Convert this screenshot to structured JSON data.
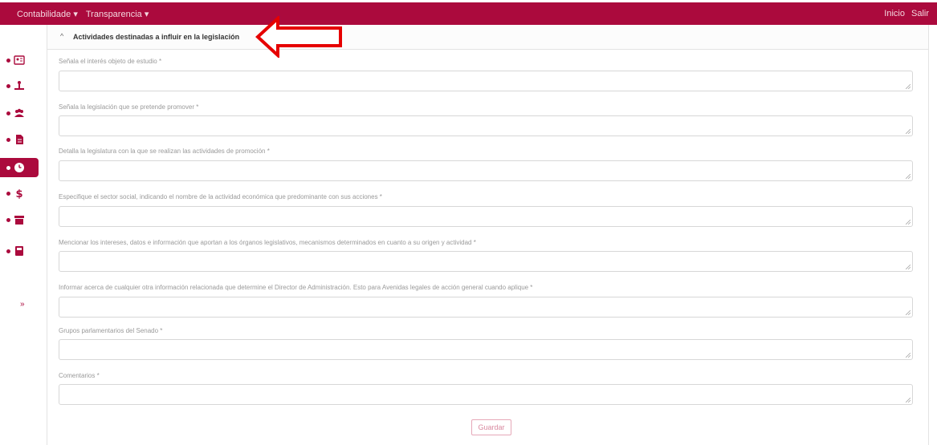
{
  "topbar": {
    "nav": [
      {
        "label": "Contabilidade ▾"
      },
      {
        "label": "Transparencia ▾"
      }
    ],
    "right": [
      {
        "label": "Inicio"
      },
      {
        "label": "Salir"
      }
    ]
  },
  "sidebar": {
    "items": [
      {
        "icon": "id-card-icon"
      },
      {
        "icon": "person-desk-icon"
      },
      {
        "icon": "group-icon"
      },
      {
        "icon": "document-icon"
      },
      {
        "icon": "clock-icon",
        "active": true
      },
      {
        "icon": "dollar-icon"
      },
      {
        "icon": "archive-icon"
      },
      {
        "icon": "book-icon"
      }
    ],
    "collapse_label": "»"
  },
  "panel": {
    "header_chevron": "^",
    "header_title": "Actividades destinadas a influir en la legislación"
  },
  "form": {
    "fields": [
      {
        "label": "Señala el interés objeto de estudio *"
      },
      {
        "label": "Señala la legislación que se pretende promover *"
      },
      {
        "label": "Detalla la legislatura con la que se realizan las actividades de promoción *"
      },
      {
        "label": "Especifique el sector social, indicando el nombre de la actividad económica que predominante con sus acciones *"
      },
      {
        "label": "Mencionar los intereses, datos e información que aportan a los órganos legislativos, mecanismos determinados en cuanto a su origen y actividad *"
      },
      {
        "label": "Informar acerca de cualquier otra información relacionada que determine el Director de Administración. Esto para Avenidas legales de acción general cuando aplique *"
      },
      {
        "label": "Grupos parlamentarios del Senado *"
      },
      {
        "label": "Comentarios *"
      }
    ],
    "save_label": "Guardar"
  },
  "colors": {
    "brand": "#ab0a3d",
    "annotation_arrow": "#e60000"
  }
}
